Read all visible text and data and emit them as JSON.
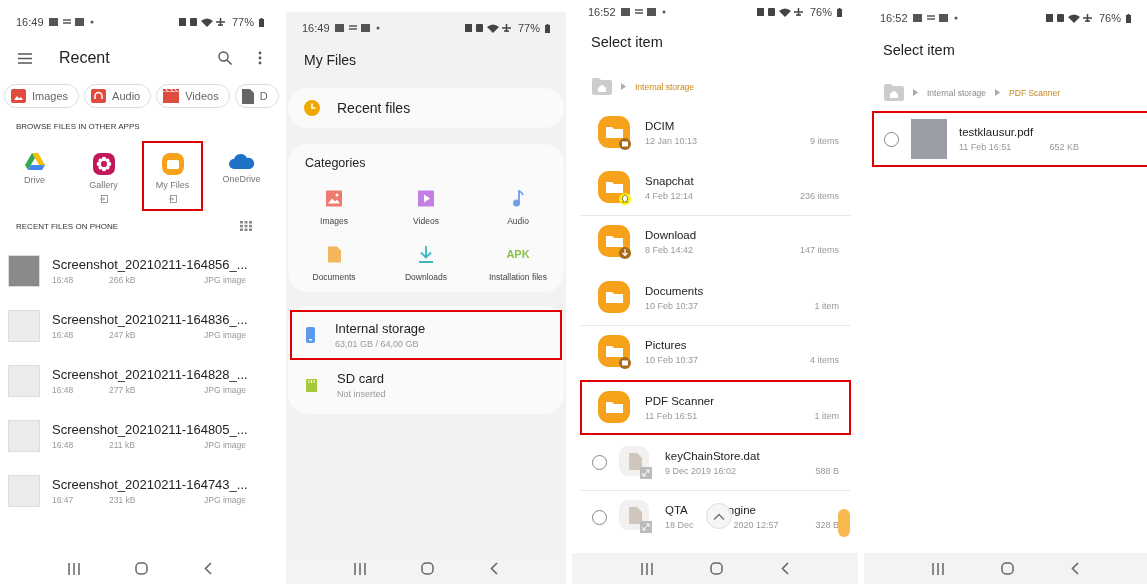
{
  "recent_screen": {
    "status_bar": {
      "time": "16:49",
      "battery": "77%"
    },
    "toolbar": {
      "title": "Recent"
    },
    "chips": [
      {
        "label": "Images",
        "kind": "images"
      },
      {
        "label": "Audio",
        "kind": "audio"
      },
      {
        "label": "Videos",
        "kind": "videos"
      },
      {
        "label": "D",
        "kind": "documents"
      }
    ],
    "apps_header": "BROWSE FILES IN OTHER APPS",
    "apps": [
      {
        "label": "Drive",
        "kind": "drive",
        "external": false,
        "highlighted": false
      },
      {
        "label": "Gallery",
        "kind": "gallery",
        "external": true,
        "highlighted": false
      },
      {
        "label": "My Files",
        "kind": "myfiles",
        "external": true,
        "highlighted": true
      },
      {
        "label": "OneDrive",
        "kind": "onedrive",
        "external": false,
        "highlighted": false
      }
    ],
    "recent_header": "RECENT FILES ON PHONE",
    "files": [
      {
        "name": "Screenshot_20210211-164856_...",
        "time": "16:48",
        "size": "266 kB",
        "type": "JPG image"
      },
      {
        "name": "Screenshot_20210211-164836_...",
        "time": "16:48",
        "size": "247 kB",
        "type": "JPG image"
      },
      {
        "name": "Screenshot_20210211-164828_...",
        "time": "16:48",
        "size": "277 kB",
        "type": "JPG image"
      },
      {
        "name": "Screenshot_20210211-164805_...",
        "time": "16:48",
        "size": "211 kB",
        "type": "JPG image"
      },
      {
        "name": "Screenshot_20210211-164743_...",
        "time": "16:47",
        "size": "231 kB",
        "type": "JPG image"
      }
    ]
  },
  "my_files_screen": {
    "status_bar": {
      "time": "16:49",
      "battery": "77%"
    },
    "title": "My Files",
    "recent_files": "Recent files",
    "categories_title": "Categories",
    "categories": [
      {
        "label": "Images",
        "kind": "images"
      },
      {
        "label": "Videos",
        "kind": "videos"
      },
      {
        "label": "Audio",
        "kind": "audio"
      },
      {
        "label": "Documents",
        "kind": "documents"
      },
      {
        "label": "Downloads",
        "kind": "downloads"
      },
      {
        "label": "Installation files",
        "kind": "apk",
        "icon_text": "APK"
      }
    ],
    "storage": [
      {
        "name": "Internal storage",
        "detail": "63,01 GB / 64,00 GB",
        "kind": "internal",
        "highlighted": true
      },
      {
        "name": "SD card",
        "detail": "Not inserted",
        "kind": "sd",
        "highlighted": false
      }
    ]
  },
  "select_screen": {
    "status_bar": {
      "time": "16:52",
      "battery": "76%"
    },
    "title": "Select item",
    "breadcrumb": [
      {
        "label": "Internal storage",
        "current": true
      }
    ],
    "folders": [
      {
        "name": "DCIM",
        "date": "12 Jan 10:13",
        "count": "9 items",
        "kind": "camera",
        "highlighted": false
      },
      {
        "name": "Snapchat",
        "date": "4 Feb 12:14",
        "count": "236 items",
        "kind": "snapchat",
        "highlighted": false
      },
      {
        "name": "Download",
        "date": "8 Feb 14:42",
        "count": "147 items",
        "kind": "download",
        "highlighted": false
      },
      {
        "name": "Documents",
        "date": "10 Feb 10:37",
        "count": "1 item",
        "kind": "plain",
        "highlighted": false
      },
      {
        "name": "Pictures",
        "date": "10 Feb 10:37",
        "count": "4 items",
        "kind": "image",
        "highlighted": false
      },
      {
        "name": "PDF Scanner",
        "date": "11 Feb 16:51",
        "count": "1 item",
        "kind": "plain",
        "highlighted": true
      }
    ],
    "files": [
      {
        "name": "keyChainStore.dat",
        "date": "9 Dec 2019 16:02",
        "size": "588 B",
        "checked": false
      },
      {
        "name": "QTA",
        "name_tail": "ngine",
        "date": "18 Dec",
        "date_tail": "2020 12:57",
        "size": "328 B",
        "checked": false
      }
    ]
  },
  "pdf_screen": {
    "status_bar": {
      "time": "16:52",
      "battery": "76%"
    },
    "title": "Select item",
    "breadcrumb": [
      {
        "label": "Internal storage",
        "current": false
      },
      {
        "label": "PDF Scanner",
        "current": true
      }
    ],
    "files": [
      {
        "name": "testklausur.pdf",
        "date": "11 Feb 16:51",
        "size": "652 KB",
        "checked": false,
        "highlighted": true
      }
    ]
  }
}
